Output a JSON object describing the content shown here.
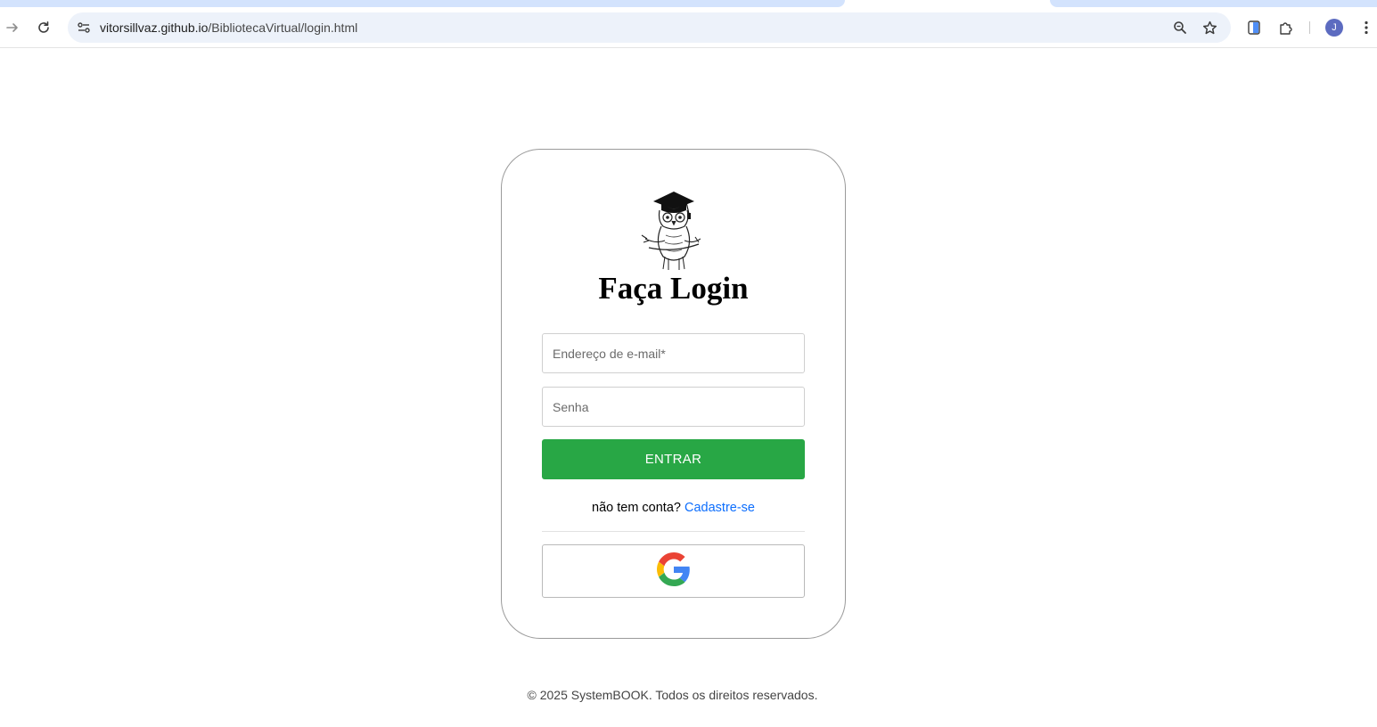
{
  "browser": {
    "url_host": "vitorsillvaz.github.io",
    "url_path": "/BibliotecaVirtual/login.html",
    "profile_initial": "J",
    "icons": [
      "forward-icon",
      "reload-icon",
      "site-info-icon",
      "zoom-icon",
      "bookmark-star-icon",
      "reading-list-icon",
      "extensions-icon",
      "menu-icon"
    ]
  },
  "login": {
    "title": "Faça Login",
    "email_placeholder": "Endereço de e-mail*",
    "password_placeholder": "Senha",
    "submit_label": "ENTRAR",
    "signup_prompt": "não tem conta? ",
    "signup_link": "Cadastre-se",
    "google_icon": "google-icon"
  },
  "colors": {
    "submit_bg": "#28a745",
    "link": "#0d6efd",
    "tab_strip": "#d3e3fd",
    "omnibox": "#edf2fa"
  },
  "footer": {
    "text": "© 2025 SystemBOOK. Todos os direitos reservados."
  }
}
